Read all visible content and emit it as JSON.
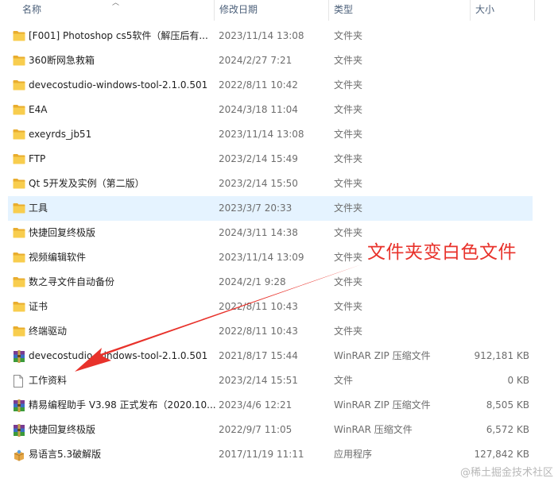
{
  "columns": {
    "name": "名称",
    "date": "修改日期",
    "type": "类型",
    "size": "大小"
  },
  "rows": [
    {
      "name": "[F001] Photoshop cs5软件（解压后有...",
      "date": "2023/11/14 13:08",
      "type": "文件夹",
      "size": "",
      "icon": "folder-icon"
    },
    {
      "name": "360断网急救箱",
      "date": "2024/2/27 7:21",
      "type": "文件夹",
      "size": "",
      "icon": "folder-icon"
    },
    {
      "name": "devecostudio-windows-tool-2.1.0.501",
      "date": "2022/8/11 10:42",
      "type": "文件夹",
      "size": "",
      "icon": "folder-icon"
    },
    {
      "name": "E4A",
      "date": "2024/3/18 11:04",
      "type": "文件夹",
      "size": "",
      "icon": "folder-icon"
    },
    {
      "name": "exeyrds_jb51",
      "date": "2023/11/14 13:08",
      "type": "文件夹",
      "size": "",
      "icon": "folder-icon"
    },
    {
      "name": "FTP",
      "date": "2023/2/14 15:49",
      "type": "文件夹",
      "size": "",
      "icon": "folder-icon"
    },
    {
      "name": "Qt 5开发及实例（第二版）",
      "date": "2023/2/14 15:50",
      "type": "文件夹",
      "size": "",
      "icon": "folder-icon"
    },
    {
      "name": "工具",
      "date": "2023/3/7 20:33",
      "type": "文件夹",
      "size": "",
      "icon": "folder-icon"
    },
    {
      "name": "快捷回复终极版",
      "date": "2024/3/11 14:38",
      "type": "文件夹",
      "size": "",
      "icon": "folder-icon"
    },
    {
      "name": "视频编辑软件",
      "date": "2023/11/14 13:09",
      "type": "文件夹",
      "size": "",
      "icon": "folder-icon"
    },
    {
      "name": "数之寻文件自动备份",
      "date": "2024/2/1 9:28",
      "type": "文件夹",
      "size": "",
      "icon": "folder-icon"
    },
    {
      "name": "证书",
      "date": "2022/8/11 10:43",
      "type": "文件夹",
      "size": "",
      "icon": "folder-icon"
    },
    {
      "name": "终端驱动",
      "date": "2022/8/11 10:43",
      "type": "文件夹",
      "size": "",
      "icon": "folder-icon"
    },
    {
      "name": "devecostudio-windows-tool-2.1.0.501",
      "date": "2021/8/17 15:44",
      "type": "WinRAR ZIP 压缩文件",
      "size": "912,181 KB",
      "icon": "winrar-archive-icon"
    },
    {
      "name": "工作资料",
      "date": "2023/2/14 15:51",
      "type": "文件",
      "size": "0 KB",
      "icon": "blank-file-icon"
    },
    {
      "name": "精易编程助手 V3.98 正式发布（2020.10...",
      "date": "2023/4/6 12:21",
      "type": "WinRAR ZIP 压缩文件",
      "size": "8,505 KB",
      "icon": "winrar-archive-icon"
    },
    {
      "name": "快捷回复终极版",
      "date": "2022/9/7 11:05",
      "type": "WinRAR 压缩文件",
      "size": "6,572 KB",
      "icon": "winrar-archive-icon"
    },
    {
      "name": "易语言5.3破解版",
      "date": "2017/11/19 11:11",
      "type": "应用程序",
      "size": "127,842 KB",
      "icon": "application-icon"
    }
  ],
  "selected_row_index": 7,
  "annotation_text": "文件夹变白色文件",
  "annotation_color": "#e8322b",
  "watermark_text": "@稀土掘金技术社区",
  "colors": {
    "folder": "#f5c342",
    "selection": "#e5f3ff",
    "header_text": "#4c607a",
    "secondary_text": "#6d6d6d"
  }
}
